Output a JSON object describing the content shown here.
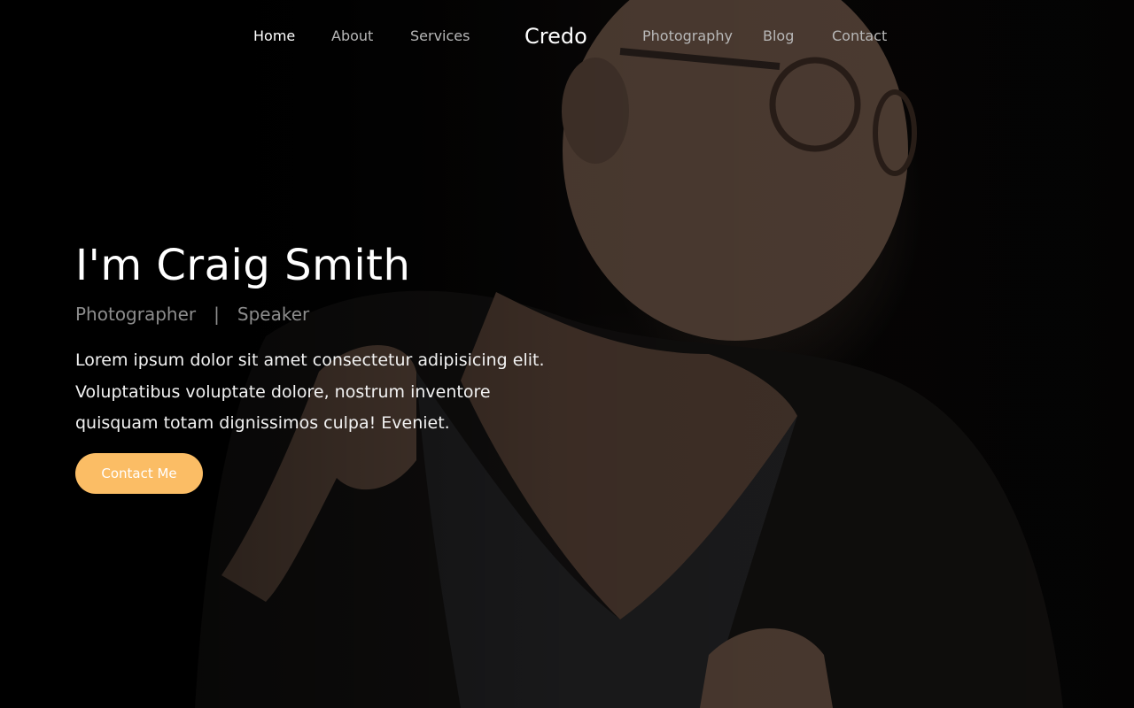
{
  "nav": {
    "left_links": [
      {
        "label": "Home",
        "active": true
      },
      {
        "label": "About",
        "active": false
      },
      {
        "label": "Services",
        "active": false
      }
    ],
    "brand": "Credo",
    "right_links": [
      {
        "label": "Photography",
        "active": false
      },
      {
        "label": "Blog",
        "active": false
      },
      {
        "label": "Contact",
        "active": false
      }
    ]
  },
  "hero": {
    "title": "I'm Craig Smith",
    "roles": [
      "Photographer",
      "Speaker"
    ],
    "roles_separator": "|",
    "description": "Lorem ipsum dolor sit amet consectetur adipisicing elit. Voluptatibus voluptate dolore, nostrum inventore quisquam totam dignissimos culpa! Eveniet.",
    "cta_label": "Contact Me"
  },
  "colors": {
    "accent": "#fbbd65",
    "background": "#000000",
    "nav_text": "#b8b8b8",
    "role_text": "#8c8c8c"
  }
}
